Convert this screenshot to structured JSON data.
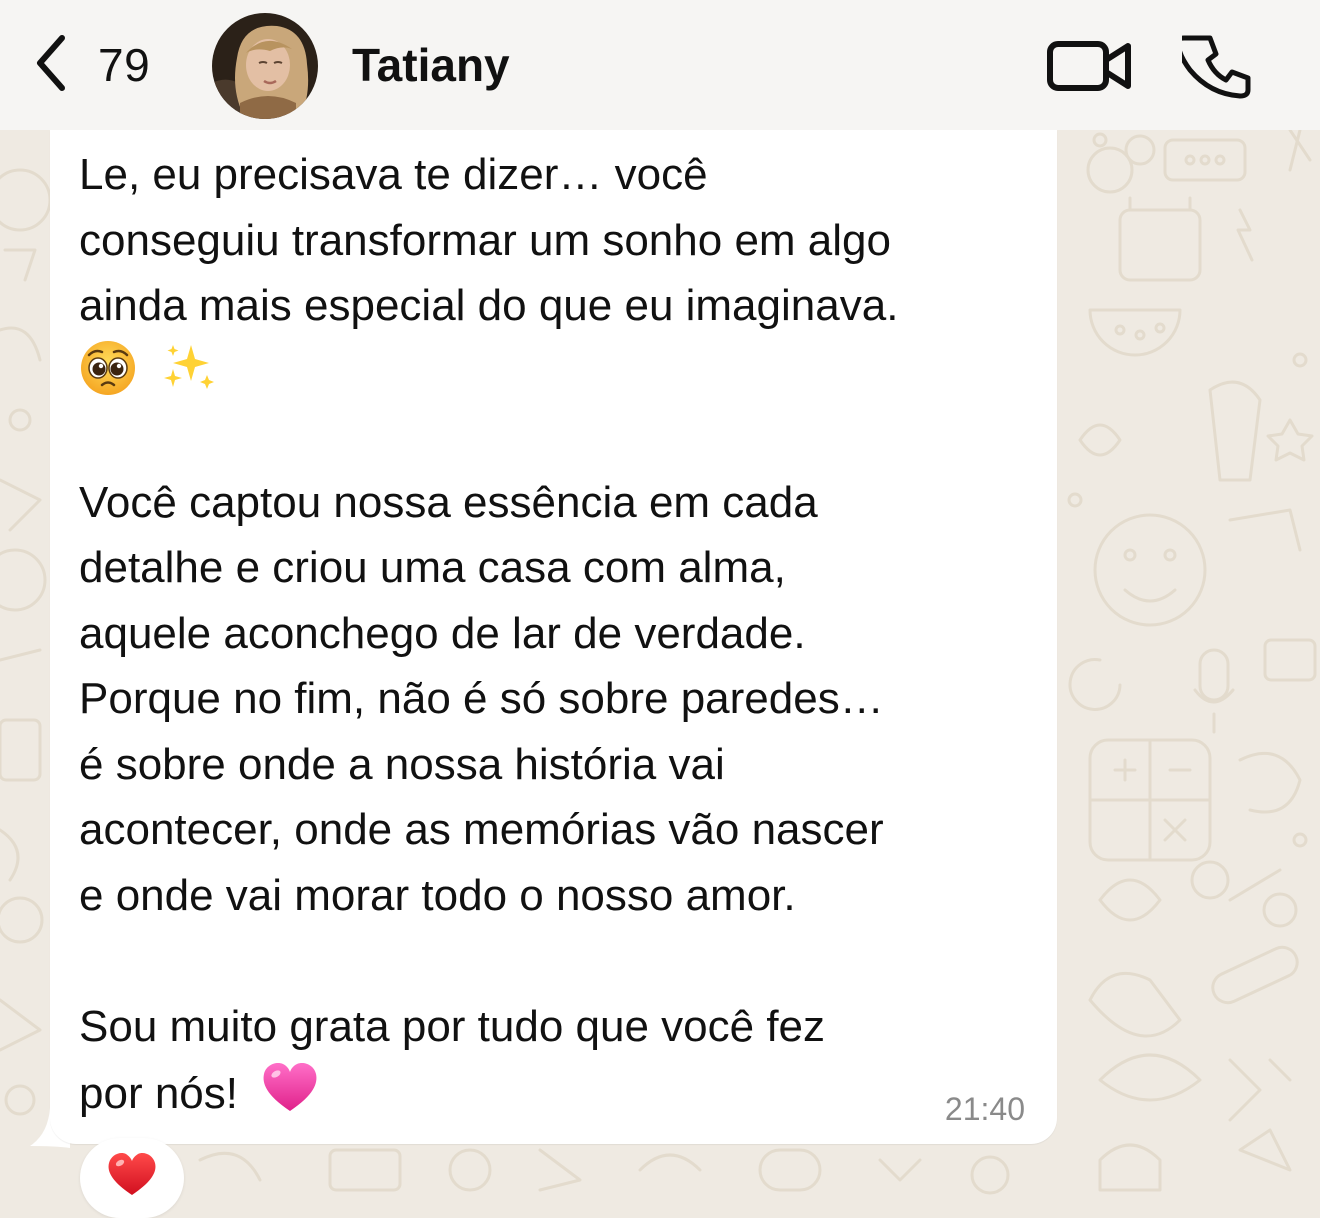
{
  "header": {
    "back_count": "79",
    "contact_name": "Tatiany"
  },
  "message": {
    "lines": [
      "Le, eu precisava te dizer… você",
      "conseguiu transformar um sonho em algo",
      "ainda mais especial do que eu imaginava.",
      "",
      "",
      "Você captou nossa essência em cada",
      "detalhe e criou uma casa com alma,",
      "aquele aconchego de lar de verdade.",
      "Porque no fim, não é só sobre paredes…",
      "é sobre onde a nossa história vai",
      "acontecer, onde as memórias vão nascer",
      "e onde vai morar todo o nosso amor.",
      "",
      "Sou muito grata por tudo que você fez",
      "por nós!"
    ],
    "time": "21:40"
  },
  "icons": {
    "back": "chevron-left-icon",
    "video": "video-camera-icon",
    "call": "phone-icon",
    "emoji_line": [
      "pleading-face-emoji",
      "sparkles-emoji"
    ],
    "inline_heart": "pink-heart-emoji",
    "reaction": "red-heart-emoji"
  },
  "colors": {
    "wallpaper": "#efeae2",
    "header_bg": "#f6f5f3",
    "bubble_bg": "#ffffff",
    "text": "#111111",
    "timestamp": "#8a8a8a"
  }
}
